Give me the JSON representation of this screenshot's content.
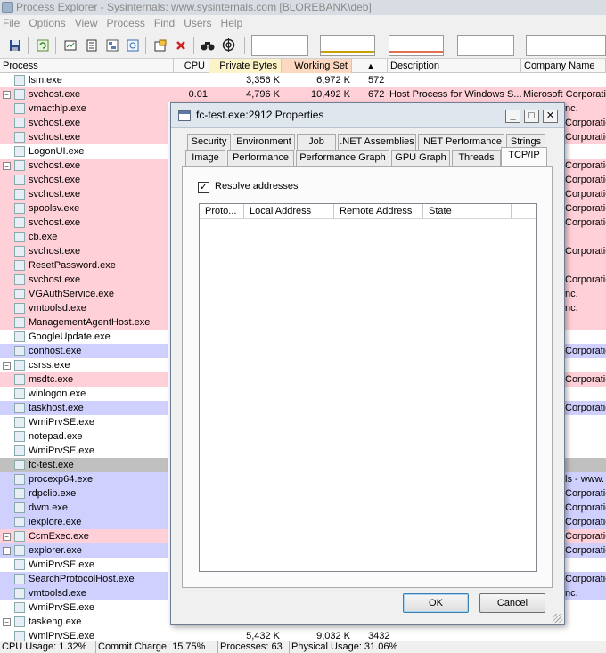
{
  "window": {
    "title": "Process Explorer - Sysinternals: www.sysinternals.com [BLOREBANK\\deb]"
  },
  "menu": [
    "File",
    "Options",
    "View",
    "Process",
    "Find",
    "Users",
    "Help"
  ],
  "toolbar": {
    "icons": [
      "save-icon",
      "refresh-icon",
      "system-info-icon",
      "properties-icon",
      "tree-icon",
      "find-window-icon",
      "kill-process-icon",
      "find-handle-icon",
      "target-icon"
    ],
    "graphs": [
      "cpu-graph",
      "commit-graph",
      "io-graph",
      "network-graph",
      "gpu-graph"
    ]
  },
  "columns": [
    "Process",
    "CPU",
    "Private Bytes",
    "Working Set",
    "▲",
    "Description",
    "Company Name"
  ],
  "colors": {
    "service": "#ffd0d8",
    "own_process": "#d0d0ff",
    "selected": "#c0c0c0",
    "working_set_header": "#fdd8c0",
    "private_bytes_header": "#fdf3c8"
  },
  "processes": [
    {
      "name": "lsm.exe",
      "hl": "none",
      "cpu": "",
      "pb": "3,356 K",
      "ws": "6,972 K",
      "pid": "572",
      "desc": "",
      "comp": "",
      "right": ""
    },
    {
      "name": "svchost.exe",
      "hl": "service",
      "exp": "⊟",
      "cpu": "0.01",
      "pb": "4,796 K",
      "ws": "10,492 K",
      "pid": "672",
      "desc": "Host Process for Windows S...",
      "comp": "Microsoft Corporation",
      "right": ""
    },
    {
      "name": "vmacthlp.exe",
      "hl": "service",
      "right": "nc."
    },
    {
      "name": "svchost.exe",
      "hl": "service",
      "right": "Corporatio"
    },
    {
      "name": "svchost.exe",
      "hl": "service",
      "right": "Corporatio"
    },
    {
      "name": "LogonUI.exe",
      "hl": "none",
      "right": ""
    },
    {
      "name": "svchost.exe",
      "hl": "service",
      "exp": "⊟",
      "right": "Corporatio"
    },
    {
      "name": "svchost.exe",
      "hl": "service",
      "right": "Corporatio"
    },
    {
      "name": "svchost.exe",
      "hl": "service",
      "right": "Corporatio"
    },
    {
      "name": "spoolsv.exe",
      "hl": "service",
      "right": "Corporatio"
    },
    {
      "name": "svchost.exe",
      "hl": "service",
      "right": "Corporatio"
    },
    {
      "name": "cb.exe",
      "hl": "service",
      "right": ""
    },
    {
      "name": "svchost.exe",
      "hl": "service",
      "right": "Corporatio"
    },
    {
      "name": "ResetPassword.exe",
      "hl": "service",
      "right": ""
    },
    {
      "name": "svchost.exe",
      "hl": "service",
      "right": "Corporatio"
    },
    {
      "name": "VGAuthService.exe",
      "hl": "service",
      "right": "nc."
    },
    {
      "name": "vmtoolsd.exe",
      "hl": "service",
      "right": "nc."
    },
    {
      "name": "ManagementAgentHost.exe",
      "hl": "service",
      "right": ""
    },
    {
      "name": "GoogleUpdate.exe",
      "hl": "none",
      "right": ""
    },
    {
      "name": "conhost.exe",
      "hl": "own",
      "right": "Corporatio"
    },
    {
      "name": "csrss.exe",
      "hl": "none",
      "exp": "⊟",
      "right": ""
    },
    {
      "name": "msdtc.exe",
      "hl": "service",
      "right": "Corporatio"
    },
    {
      "name": "winlogon.exe",
      "hl": "none",
      "right": ""
    },
    {
      "name": "taskhost.exe",
      "hl": "own",
      "right": "Corporatio"
    },
    {
      "name": "WmiPrvSE.exe",
      "hl": "none",
      "right": ""
    },
    {
      "name": "notepad.exe",
      "hl": "none",
      "right": ""
    },
    {
      "name": "WmiPrvSE.exe",
      "hl": "none",
      "right": ""
    },
    {
      "name": "fc-test.exe",
      "hl": "selected",
      "right": ""
    },
    {
      "name": "procexp64.exe",
      "hl": "own",
      "right": "ls - www."
    },
    {
      "name": "rdpclip.exe",
      "hl": "own",
      "right": "Corporatio"
    },
    {
      "name": "dwm.exe",
      "hl": "own",
      "right": "Corporatio"
    },
    {
      "name": "iexplore.exe",
      "hl": "own",
      "right": "Corporatio"
    },
    {
      "name": "CcmExec.exe",
      "hl": "service",
      "exp": "⊟",
      "right": "Corporatio"
    },
    {
      "name": "explorer.exe",
      "hl": "own",
      "exp": "⊟",
      "right": "Corporatio"
    },
    {
      "name": "WmiPrvSE.exe",
      "hl": "none",
      "right": ""
    },
    {
      "name": "SearchProtocolHost.exe",
      "hl": "own",
      "right": "Corporatio"
    },
    {
      "name": "vmtoolsd.exe",
      "hl": "own",
      "right": "nc."
    },
    {
      "name": "WmiPrvSE.exe",
      "hl": "none",
      "right": ""
    },
    {
      "name": "taskeng.exe",
      "hl": "none",
      "exp": "⊟",
      "right": ""
    },
    {
      "name": "WmiPrvSE.exe",
      "hl": "none",
      "cpu": "",
      "pb": "5,432 K",
      "ws": "9,032 K",
      "pid": "3432",
      "right": ""
    }
  ],
  "status": {
    "cpu": "CPU Usage: 1.32%",
    "commit": "Commit Charge: 15.75%",
    "processes": "Processes: 63",
    "physical": "Physical Usage: 31.06%"
  },
  "dialog": {
    "title": "fc-test.exe:2912 Properties",
    "tabs_row1": [
      "Security",
      "Environment",
      "Job",
      ".NET Assemblies",
      ".NET Performance",
      "Strings"
    ],
    "tabs_row2": [
      "Image",
      "Performance",
      "Performance Graph",
      "GPU Graph",
      "Threads",
      "TCP/IP"
    ],
    "active_tab": "TCP/IP",
    "resolve_label": "Resolve addresses",
    "resolve_checked": true,
    "check_mark": "✓",
    "columns": [
      "Proto...",
      "Local Address",
      "Remote Address",
      "State"
    ],
    "ok_label": "OK",
    "cancel_label": "Cancel",
    "min_glyph": "_",
    "max_glyph": "□",
    "close_glyph": "✕"
  }
}
